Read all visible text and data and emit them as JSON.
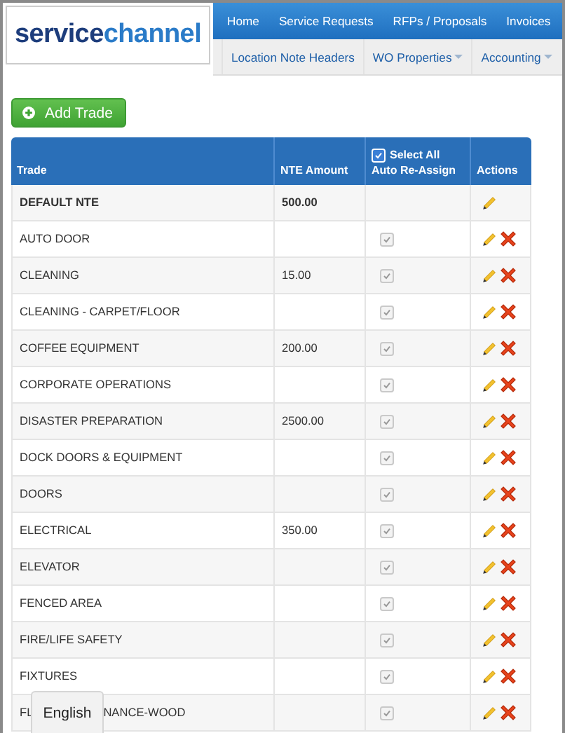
{
  "logo": {
    "first": "service",
    "second": "channel"
  },
  "top_nav": [
    {
      "label": "Home",
      "dropdown": false
    },
    {
      "label": "Service Requests",
      "dropdown": false
    },
    {
      "label": "RFPs / Proposals",
      "dropdown": false
    },
    {
      "label": "Invoices",
      "dropdown": false
    }
  ],
  "sub_nav": [
    {
      "label": "Location Note Headers",
      "dropdown": false
    },
    {
      "label": "WO Properties",
      "dropdown": true
    },
    {
      "label": "Accounting",
      "dropdown": true
    }
  ],
  "add_button": "Add Trade",
  "table": {
    "columns": [
      "Trade",
      "NTE Amount",
      "Auto Re-Assign",
      "Actions"
    ],
    "select_all": {
      "label": "Select All",
      "checked": true
    },
    "rows": [
      {
        "trade": "DEFAULT NTE",
        "nte": "500.00",
        "bold": true,
        "auto_reassign": null,
        "deletable": false
      },
      {
        "trade": "AUTO DOOR",
        "nte": "",
        "bold": false,
        "auto_reassign": true,
        "deletable": true
      },
      {
        "trade": "CLEANING",
        "nte": "15.00",
        "bold": false,
        "auto_reassign": true,
        "deletable": true
      },
      {
        "trade": "CLEANING - CARPET/FLOOR",
        "nte": "",
        "bold": false,
        "auto_reassign": true,
        "deletable": true
      },
      {
        "trade": "COFFEE EQUIPMENT",
        "nte": "200.00",
        "bold": false,
        "auto_reassign": true,
        "deletable": true
      },
      {
        "trade": "CORPORATE OPERATIONS",
        "nte": "",
        "bold": false,
        "auto_reassign": true,
        "deletable": true
      },
      {
        "trade": "DISASTER PREPARATION",
        "nte": "2500.00",
        "bold": false,
        "auto_reassign": true,
        "deletable": true
      },
      {
        "trade": "DOCK DOORS & EQUIPMENT",
        "nte": "",
        "bold": false,
        "auto_reassign": true,
        "deletable": true
      },
      {
        "trade": "DOORS",
        "nte": "",
        "bold": false,
        "auto_reassign": true,
        "deletable": true
      },
      {
        "trade": "ELECTRICAL",
        "nte": "350.00",
        "bold": false,
        "auto_reassign": true,
        "deletable": true
      },
      {
        "trade": "ELEVATOR",
        "nte": "",
        "bold": false,
        "auto_reassign": true,
        "deletable": true
      },
      {
        "trade": "FENCED AREA",
        "nte": "",
        "bold": false,
        "auto_reassign": true,
        "deletable": true
      },
      {
        "trade": "FIRE/LIFE SAFETY",
        "nte": "",
        "bold": false,
        "auto_reassign": true,
        "deletable": true
      },
      {
        "trade": "FIXTURES",
        "nte": "",
        "bold": false,
        "auto_reassign": true,
        "deletable": true
      },
      {
        "trade": "FL",
        "trade_end": "NANCE-WOOD",
        "nte": "",
        "bold": false,
        "auto_reassign": true,
        "deletable": true
      }
    ]
  },
  "language_tab": "English"
}
